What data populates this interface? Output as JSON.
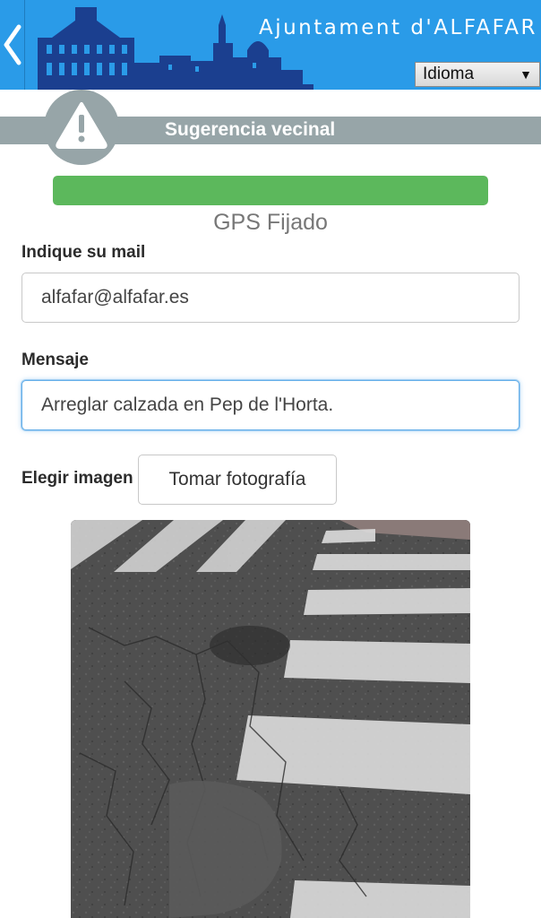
{
  "header": {
    "title": "Ajuntament d'ALFAFAR",
    "language_select": {
      "selected": "Idioma"
    },
    "icons": {
      "back": "chevron-left-icon",
      "logo": "town-skyline-logo",
      "caret": "caret-down-icon"
    },
    "colors": {
      "bar": "#2a9be8"
    }
  },
  "section": {
    "title": "Sugerencia vecinal",
    "icon": "warning-icon",
    "color": "#97a5a8"
  },
  "gps": {
    "progress": 1.0,
    "status": "GPS Fijado",
    "color": "#5cb85c"
  },
  "form": {
    "email": {
      "label": "Indique su mail",
      "value": "alfafar@alfafar.es"
    },
    "message": {
      "label": "Mensaje",
      "value": "Arreglar calzada en Pep de l'Horta."
    },
    "image": {
      "label": "Elegir imagen",
      "button": "Tomar fotografía"
    }
  },
  "photo": {
    "icon": "photo-preview"
  }
}
